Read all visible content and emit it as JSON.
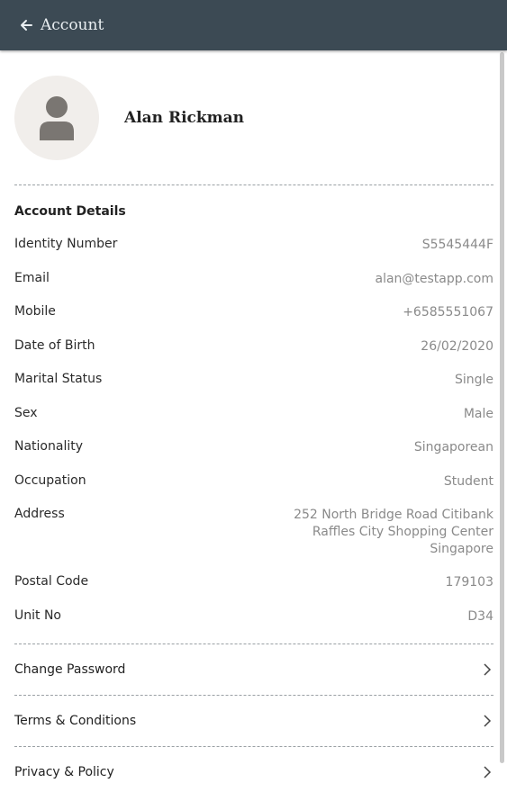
{
  "header": {
    "title": "Account"
  },
  "profile": {
    "name": "Alan Rickman"
  },
  "account_details": {
    "section_title": "Account Details",
    "rows": [
      {
        "label": "Identity Number",
        "value": "S5545444F"
      },
      {
        "label": "Email",
        "value": "alan@testapp.com"
      },
      {
        "label": "Mobile",
        "value": "+6585551067"
      },
      {
        "label": "Date of Birth",
        "value": "26/02/2020"
      },
      {
        "label": "Marital Status",
        "value": "Single"
      },
      {
        "label": "Sex",
        "value": "Male"
      },
      {
        "label": "Nationality",
        "value": "Singaporean"
      },
      {
        "label": "Occupation",
        "value": "Student"
      },
      {
        "label": "Address",
        "value_lines": [
          "252 North Bridge Road Citibank",
          "Raffles City Shopping Center",
          "Singapore"
        ]
      },
      {
        "label": "Postal Code",
        "value": "179103"
      },
      {
        "label": "Unit No",
        "value": "D34"
      }
    ]
  },
  "links": [
    {
      "label": "Change Password"
    },
    {
      "label": "Terms & Conditions"
    },
    {
      "label": "Privacy & Policy"
    }
  ],
  "colors": {
    "appbar": "#3c4a54",
    "avatar_bg": "#f1eeeb",
    "avatar_icon": "#7a7672"
  },
  "icons": {
    "back": "arrow-left-icon",
    "avatar": "person-icon",
    "chevron": "chevron-right-icon"
  }
}
